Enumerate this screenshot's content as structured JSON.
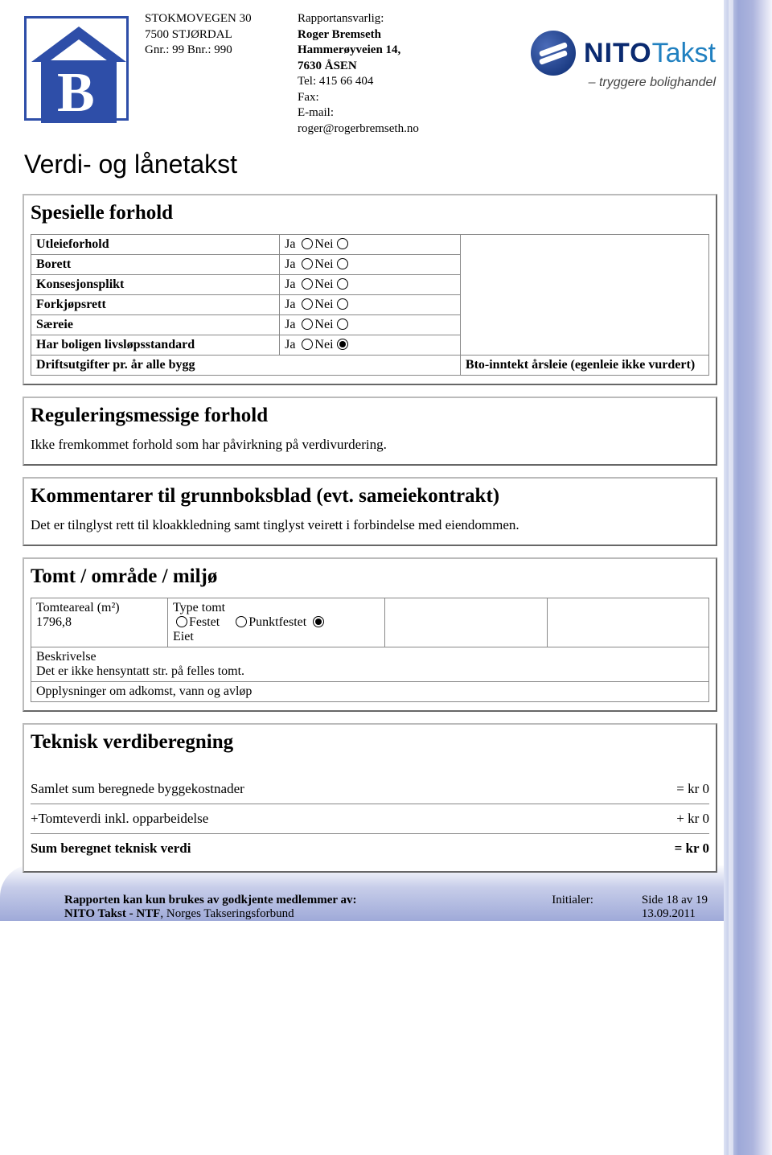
{
  "header": {
    "property": {
      "line1": "STOKMOVEGEN 30",
      "line2": "7500 STJØRDAL",
      "line3": "Gnr.: 99 Bnr.: 990"
    },
    "responsible": {
      "label": "Rapportansvarlig:",
      "name": "Roger Bremseth",
      "addr1": "Hammerøyveien 14,",
      "addr2": "7630 ÅSEN",
      "tel": "Tel: 415 66 404",
      "fax": "Fax:",
      "email_label": "E-mail:",
      "email": "roger@rogerbremseth.no"
    },
    "nito": {
      "brand1": "NITO",
      "brand2": "Takst",
      "tagline": "– tryggere bolighandel"
    }
  },
  "title": "Verdi- og lånetakst",
  "spesielle": {
    "heading": "Spesielle forhold",
    "yes": "Ja",
    "no": "Nei",
    "rows": [
      {
        "label": "Utleieforhold",
        "ja": false,
        "nei": false
      },
      {
        "label": "Borett",
        "ja": false,
        "nei": false
      },
      {
        "label": "Konsesjonsplikt",
        "ja": false,
        "nei": false
      },
      {
        "label": "Forkjøpsrett",
        "ja": false,
        "nei": false
      },
      {
        "label": "Særeie",
        "ja": false,
        "nei": false
      },
      {
        "label": "Har boligen livsløpsstandard",
        "ja": false,
        "nei": true
      }
    ],
    "drifts_label": "Driftsutgifter pr. år alle bygg",
    "bto_label": "Bto-inntekt årsleie (egenleie ikke vurdert)"
  },
  "regulering": {
    "heading": "Reguleringsmessige forhold",
    "body": "Ikke fremkommet forhold som har påvirkning på verdivurdering."
  },
  "kommentarer": {
    "heading": "Kommentarer til grunnboksblad (evt. sameiekontrakt)",
    "body": "Det er tilnglyst rett til kloakkledning samt tinglyst veirett i forbindelse med eiendommen."
  },
  "tomt": {
    "heading": "Tomt / område / miljø",
    "areal_label": "Tomteareal (m²)",
    "areal_value": "1796,8",
    "type_label": "Type tomt",
    "opt_festet": "Festet",
    "opt_punkt": "Punktfestet",
    "opt_eiet": "Eiet",
    "beskrivelse_label": "Beskrivelse",
    "beskrivelse_body": "Det er ikke hensyntatt str. på felles tomt.",
    "opplysninger_label": "Opplysninger om adkomst, vann og avløp"
  },
  "teknisk": {
    "heading": "Teknisk verdiberegning",
    "rows": [
      {
        "label": "Samlet sum beregnede byggekostnader",
        "value": "= kr 0",
        "bold": false
      },
      {
        "label": "+Tomteverdi inkl. opparbeidelse",
        "value": "+ kr 0",
        "bold": false
      },
      {
        "label": "Sum beregnet teknisk verdi",
        "value": "= kr 0",
        "bold": true
      }
    ]
  },
  "footer": {
    "line1a": "Rapporten kan kun brukes av godkjente medlemmer av:",
    "line1b": "NITO Takst - NTF",
    "line1c": ", Norges Takseringsforbund",
    "initialer": "Initialer:",
    "side": "Side 18 av 19",
    "dato": "13.09.2011"
  }
}
